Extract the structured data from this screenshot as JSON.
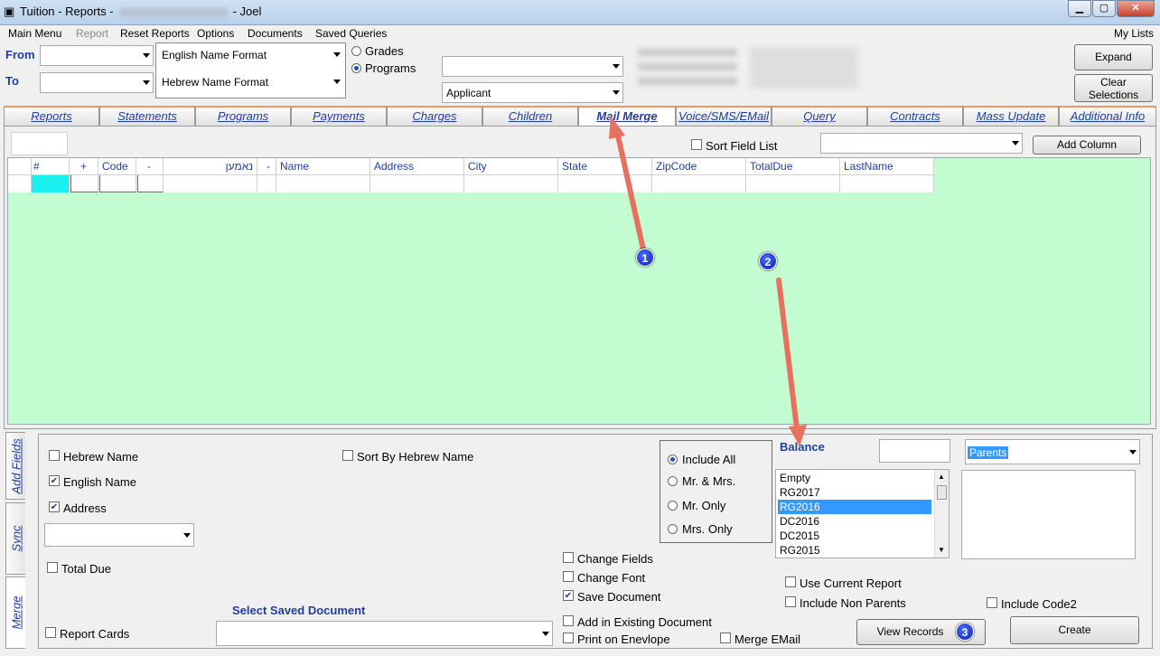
{
  "window": {
    "title_prefix": "Tuition - Reports -",
    "title_user": "- Joel",
    "min": "▁",
    "max": "▢",
    "close": "✕"
  },
  "menu": {
    "items": [
      "Main Menu",
      "Report",
      "Reset Reports",
      "Options",
      "Documents",
      "Saved Queries"
    ],
    "right": "My Lists"
  },
  "filters": {
    "from_label": "From",
    "to_label": "To",
    "name_format_1": "English Name Format",
    "name_format_2": "Hebrew Name Format",
    "radio_grades": "Grades",
    "radio_programs": "Programs",
    "combo_top": "",
    "combo_applicant": "Applicant"
  },
  "buttons": {
    "expand": "Expand",
    "clear": "Clear Selections",
    "add_column": "Add Column",
    "view_records": "View Records",
    "create": "Create"
  },
  "tabs": [
    "Reports",
    "Statements",
    "Programs",
    "Payments",
    "Charges",
    "Children",
    "Mail Merge",
    "Voice/SMS/EMail",
    "Query",
    "Contracts",
    "Mass Update",
    "Additional Info"
  ],
  "active_tab": "Mail Merge",
  "grid": {
    "sort_field_list": "Sort Field List",
    "columns": [
      "#",
      "+",
      "Code",
      "-",
      "נאמען",
      "-",
      "Name",
      "Address",
      "City",
      "State",
      "ZipCode",
      "TotalDue",
      "LastName"
    ]
  },
  "side_tabs": [
    "Add Fields",
    "Sync",
    "Merge"
  ],
  "merge": {
    "hebrew_name": "Hebrew Name",
    "english_name": "English Name",
    "address": "Address",
    "total_due": "Total Due",
    "report_cards": "Report Cards",
    "sort_by_hebrew": "Sort By Hebrew Name",
    "select_saved_document": "Select Saved Document",
    "change_fields": "Change Fields",
    "change_font": "Change Font",
    "save_document": "Save Document",
    "add_existing": "Add in Existing Document",
    "print_envelope": "Print on Enevlope",
    "merge_email": "Merge EMail",
    "include_all": "Include All",
    "mr_mrs": "Mr. & Mrs.",
    "mr_only": "Mr. Only",
    "mrs_only": "Mrs. Only",
    "balance": "Balance",
    "parents": "Parents",
    "balance_list": [
      "Empty",
      "RG2017",
      "RG2016",
      "DC2016",
      "DC2015",
      "RG2015"
    ],
    "balance_selected": "RG2016",
    "use_current_report": "Use Current Report",
    "include_non_parents": "Include Non Parents",
    "include_code2": "Include Code2"
  },
  "markers": [
    "1",
    "2",
    "3"
  ],
  "colors": {
    "grid_bg": "#c2fcd0",
    "accent": "#1f3fa0",
    "arrow": "#e8705f",
    "selection": "#3399ff"
  }
}
